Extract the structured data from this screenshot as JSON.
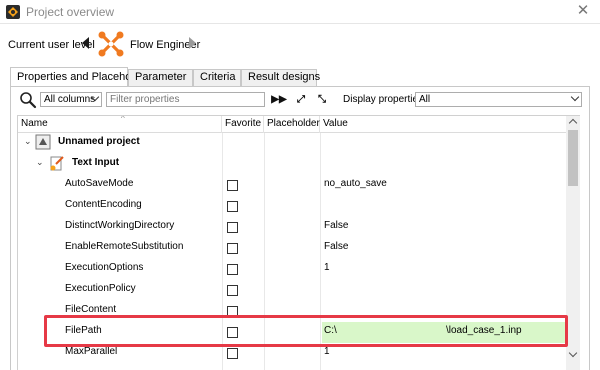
{
  "window": {
    "title": "Project overview",
    "close_glyph": "✕"
  },
  "user_level": {
    "label": "Current user level",
    "name": "Flow Engineer",
    "icon": "wrench-cross-icon",
    "icon_color": "#f07a20"
  },
  "tabs": [
    {
      "label": "Properties and Placeholders",
      "active": true
    },
    {
      "label": "Parameter",
      "active": false
    },
    {
      "label": "Criteria",
      "active": false
    },
    {
      "label": "Result designs",
      "active": false
    }
  ],
  "toolbar": {
    "columns_select": "All columns",
    "filter_placeholder": "Filter properties",
    "display_label": "Display properties:",
    "display_select": "All",
    "expand_glyph": "▶▶",
    "expand_all_glyph": "⤢",
    "collapse_all_glyph": "⤡"
  },
  "grid": {
    "headers": {
      "name": "Name",
      "favorite": "Favorite",
      "placeholder": "Placeholder",
      "value": "Value"
    },
    "project": {
      "label": "Unnamed project"
    },
    "node": {
      "label": "Text Input"
    },
    "rows": [
      {
        "name": "AutoSaveMode",
        "favorite": false,
        "value": "no_auto_save"
      },
      {
        "name": "ContentEncoding",
        "favorite": false,
        "value": ""
      },
      {
        "name": "DistinctWorkingDirectory",
        "favorite": false,
        "value": "False"
      },
      {
        "name": "EnableRemoteSubstitution",
        "favorite": false,
        "value": "False"
      },
      {
        "name": "ExecutionOptions",
        "favorite": false,
        "value": "1"
      },
      {
        "name": "ExecutionPolicy",
        "favorite": false,
        "value": ""
      },
      {
        "name": "FileContent",
        "favorite": false,
        "value": ""
      },
      {
        "name": "FilePath",
        "favorite": false,
        "value_prefix": "C:\\",
        "value_suffix": "\\load_case_1.inp",
        "highlighted": true
      },
      {
        "name": "MaxParallel",
        "favorite": false,
        "value": "1"
      }
    ]
  },
  "colors": {
    "highlight_fill": "#d9f7c9",
    "annotation_border": "#e63946"
  }
}
